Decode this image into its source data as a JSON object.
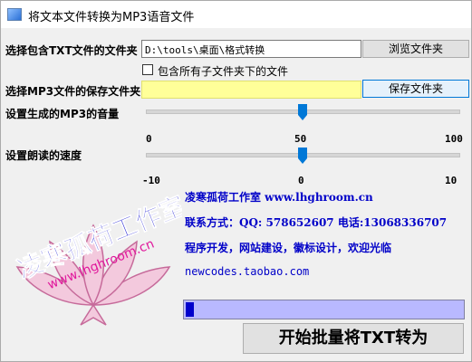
{
  "window": {
    "title": "将文本文件转换为MP3语音文件"
  },
  "source": {
    "label": "选择包含TXT文件的文件夹",
    "path": "D:\\tools\\桌面\\格式转换",
    "browse_label": "浏览文件夹",
    "include_subfolders_label": "包含所有子文件夹下的文件",
    "include_subfolders_checked": false
  },
  "output": {
    "label": "选择MP3文件的保存文件夹",
    "path": "",
    "save_label": "保存文件夹",
    "field_color": "#ffff99"
  },
  "volume": {
    "label": "设置生成的MP3的音量",
    "min_label": "0",
    "mid_label": "50",
    "max_label": "100",
    "min": 0,
    "max": 100,
    "value": 50
  },
  "speed": {
    "label": "设置朗读的速度",
    "min_label": "-10",
    "mid_label": "0",
    "max_label": "10",
    "min": -10,
    "max": 10,
    "value": 0
  },
  "logo": {
    "text_main": "凌寒孤荷工作室",
    "text_url": "www.lhghroom.cn",
    "main_color": "#1515d0",
    "url_color": "#e0189c",
    "flower_color": "#e8a0c8"
  },
  "info": {
    "line1": "凌寒孤荷工作室 www.lhghroom.cn",
    "line2": "联系方式：QQ: 578652607 电话:13068336707",
    "line3": "程序开发，网站建设，徽标设计，欢迎光临",
    "line4": "newcodes.taobao.com",
    "color": "#0000c8"
  },
  "progress": {
    "value": 0.03,
    "fill_color": "#0000cc",
    "track_color": "#b9b9ff"
  },
  "convert_button": {
    "label": "开始批量将TXT转为"
  }
}
